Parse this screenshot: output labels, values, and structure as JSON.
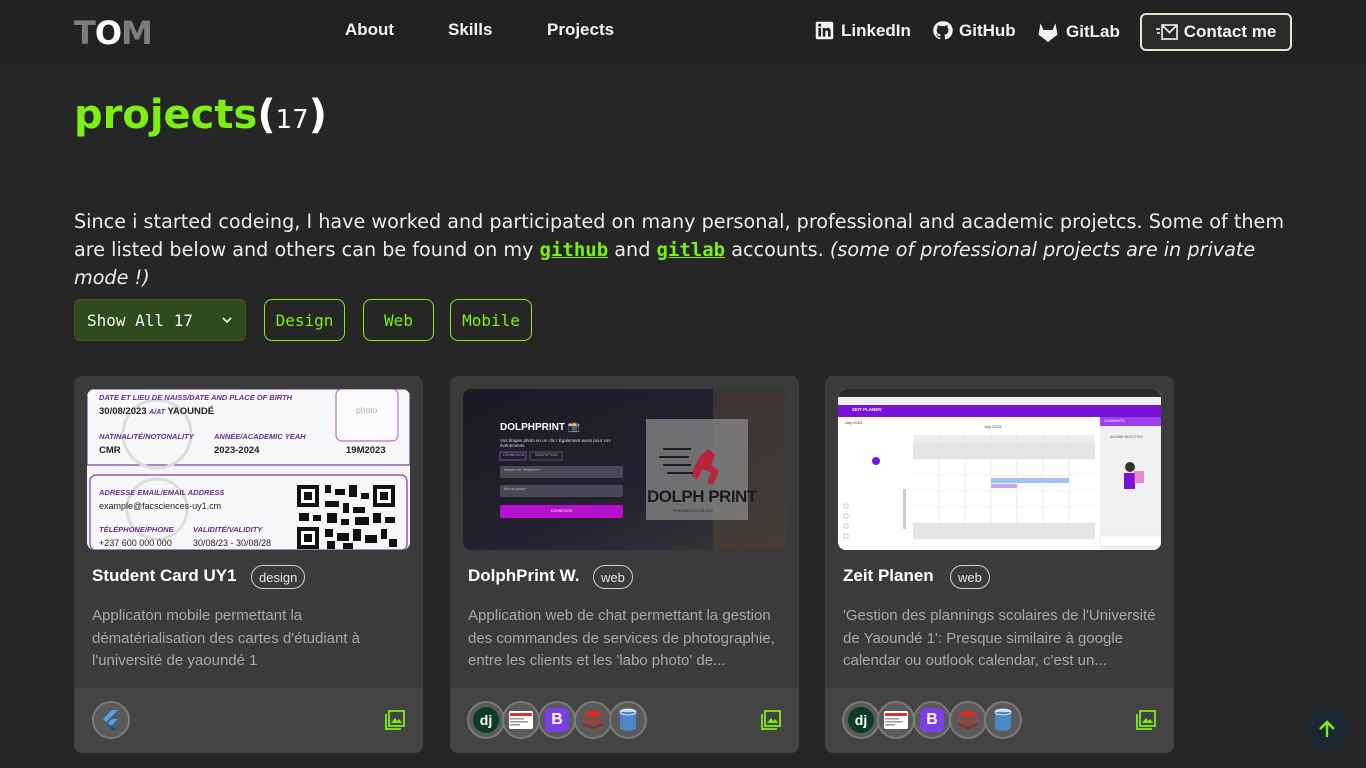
{
  "header": {
    "logo": {
      "t": "T",
      "o": "O",
      "m": "M"
    },
    "nav": [
      {
        "label": "About"
      },
      {
        "label": "Skills"
      },
      {
        "label": "Projects"
      }
    ],
    "social": [
      {
        "label": "LinkedIn",
        "icon": "linkedin-icon"
      },
      {
        "label": "GitHub",
        "icon": "github-icon"
      },
      {
        "label": "GitLab",
        "icon": "gitlab-icon"
      }
    ],
    "contact_label": "Contact me"
  },
  "page": {
    "title": "projects",
    "count": "17",
    "intro_1": "Since i started codeing, I have worked and participated on many personal, professional and academic projetcs. Some of them are listed below and others can be found on my ",
    "link_github": "github",
    "intro_and": " and ",
    "link_gitlab": "gitlab",
    "intro_2": " accounts. ",
    "intro_note": "(some of professional projects are in private mode !)"
  },
  "filters": {
    "select_value": "Show All 17",
    "buttons": [
      "Design",
      "Web",
      "Mobile"
    ]
  },
  "projects": [
    {
      "name": "Student Card UY1",
      "tag": "design",
      "description": "Applicaton mobile permettant la dématérialisation des cartes d'étudiant à l'université de yaoundé 1",
      "tech": [
        "flutter"
      ],
      "thumb": {
        "birth_label": "DATE ET LIEU DE NAISS/DATE AND PLACE OF BIRTH",
        "birth_value": "30/08/2023",
        "birth_at": "A/AT",
        "birth_place": "YAOUNDÉ",
        "photo": "photo",
        "nat_label": "NATINALITÉ/NOTONALITY",
        "nat_value": "CMR",
        "year_label": "ANNÉE/ACADEMIC YEAH",
        "year_value": "2023-2024",
        "matricule": "19M2023",
        "email_label": "ADRESSE EMAIL/EMAIL ADDRESS",
        "email_value": "example@facsciences-uy1.cm",
        "phone_label": "TÉLÉPHONE/PHONE",
        "phone_value": "+237 600 000 000",
        "validity_label": "VALIDITÉ/VALIDITY",
        "validity_value": "30/08/23 - 30/08/28"
      }
    },
    {
      "name": "DolphPrint W.",
      "tag": "web",
      "description": "Application web de chat permettant la gestion des commandes de services de photographie, entre les clients et les 'labo photo' de...",
      "tech": [
        "django",
        "swagger",
        "bootstrap",
        "redis",
        "database"
      ],
      "thumb": {
        "brand": "DOLPHPRINT 📸",
        "tagline": "Vos tirages photo en un clic ! Également aussi pour vos événements",
        "tab1": "CONNEXION",
        "tab2": "INSCRIPTION",
        "field1": "Numéro de Téléphone *",
        "field2": "Mot de passe *",
        "submit": "CONNEXION",
        "logo": "DOLPH PRINT",
        "logo_sub": "PRINTABLE EN UN CLIC"
      }
    },
    {
      "name": "Zeit Planen",
      "tag": "web",
      "description": "'Gestion des plannings scolaires de l'Université de Yaoundé 1': Presque similaire à google calendar ou outlook calendar, c'est un...",
      "tech": [
        "django",
        "swagger",
        "bootstrap",
        "redis",
        "database"
      ],
      "thumb": {
        "app": "ZEIT PLANEN",
        "month": "July 2023",
        "comments": "COMMENTS",
        "no_selection": "AUCUNE SELECTION"
      }
    }
  ],
  "colors": {
    "accent": "#7cf015",
    "background": "#262626",
    "card": "#3b3b3b"
  }
}
